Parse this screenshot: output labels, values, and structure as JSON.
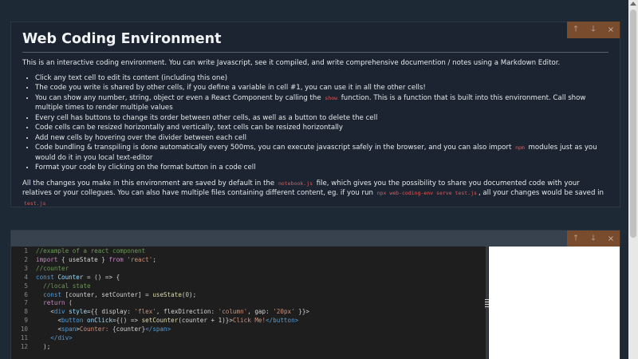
{
  "text_cell": {
    "title": "Web Coding Environment",
    "intro": "This is an interactive coding environment. You can write Javascript, see it compiled, and write comprehensive documention / notes using a Markdown Editor.",
    "bullets": [
      "Click any text cell to edit its content (including this one)",
      "The code you write is shared by other cells, if you define a variable in cell #1, you can use it in all the other cells!",
      "Every cell has buttons to change its order between other cells, as well as a button to delete the cell",
      "Code cells can be resized horizontally and vertically, text cells can be resized horizontally",
      "Add new cells by hovering over the divider between each cell",
      "Format your code by clicking on the format button in a code cell"
    ],
    "bullet_show": {
      "before": "You can show any number, string, object or even a React Component by calling the",
      "code": "show",
      "after": "function. This is a function that is built into this environment. Call show multiple times to render multiple values"
    },
    "bullet_npm": {
      "before": "Code bundling & transpiling is done automatically every 500ms, you can execute javascript safely in the browser, and you can also import",
      "code": "npm",
      "after": "modules just as you would do it in you local text-editor"
    },
    "outro": {
      "part1": "All the changes you make in this environment are saved by default in the",
      "code1": "notebook.js",
      "part2": "file, which gives you the possibility to share you documented code with your relatives or your collegues. You can also have multiple files containing different content, eg. if you run",
      "code2": "npx web-coding-env serve test.js",
      "part3": ", all your changes would be saved in",
      "code3": "test.js"
    }
  },
  "cell_actions": {
    "move_up": "🡑",
    "move_down": "🡓",
    "delete": "×"
  },
  "code_cell": {
    "line_numbers": [
      "1",
      "2",
      "3",
      "4",
      "5",
      "6",
      "7",
      "8",
      "9",
      "10",
      "11",
      "12"
    ],
    "code_tokens": {
      "l1": "//example of a react component",
      "l2_import": "import",
      "l2_mid": " { useState } ",
      "l2_from": "from",
      "l2_str": "'react'",
      "l2_end": ";",
      "l3": "//counter",
      "l4_const": "const",
      "l4_name": "Counter",
      "l4_rest": " = () => {",
      "l5": "//local state",
      "l6_const": "const",
      "l6_rest": " [counter, setCounter] = ",
      "l6_fn": "useState",
      "l6_open": "(",
      "l6_num": "0",
      "l6_end": ");",
      "l7_return": "return",
      "l7_rest": " (",
      "l8_open": "<",
      "l8_tag": "div",
      "l8_attr": " style",
      "l8_mid": "={{ display: ",
      "l8_s1": "'flex'",
      "l8_mid2": ", flexDirection: ",
      "l8_s2": "'column'",
      "l8_mid3": ", gap: ",
      "l8_s3": "'20px'",
      "l8_end": " }}>",
      "l9_open": "<",
      "l9_tag": "button",
      "l9_attr": " onClick",
      "l9_mid": "={() => ",
      "l9_fn": "setCounter",
      "l9_mid2": "(counter + 1)}>",
      "l9_text": "Click Me!",
      "l9_close": "</button>",
      "l10_open": "<",
      "l10_tag": "span",
      "l10_gt": ">",
      "l10_text": "Counter: ",
      "l10_expr": "{counter}",
      "l10_close": "</span>",
      "l11_close": "</div>",
      "l12": ");"
    }
  }
}
